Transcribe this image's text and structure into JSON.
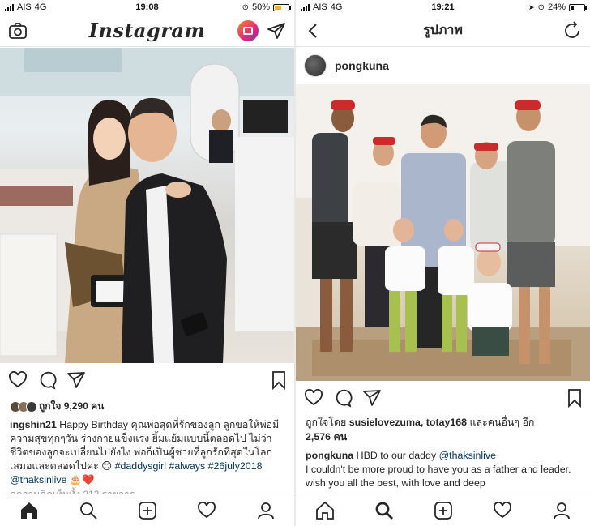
{
  "left": {
    "status": {
      "carrier": "AIS",
      "network": "4G",
      "time": "19:08",
      "battery": "50%"
    },
    "header": {
      "logo": "Instagram"
    },
    "post": {
      "likes_text": "ถูกใจ 9,290 คน",
      "caption_user": "ingshin21",
      "caption_text": " Happy Birthday คุณพ่อสุดที่รักของลูก ลูกขอให้พ่อมีความสุขทุกๆวัน ร่างกายแข็งแรง ยิ้มแย้มแบบนี้ตลอดไป ไม่ว่าชีวิตของลูกจะเปลี่ยนไปยังไง พ่อก็เป็นผู้ชายที่ลูกรักที่สุดในโลกเสมอและตลอดไปค่ะ 😊 ",
      "hashtags": "#daddysgirl #always #26july2018",
      "mention": "@thaksinlive",
      "emoji_tail": " 🎂❤️",
      "comments_link": "ดูความคิดเห็นทั้ง 213 รายการ"
    }
  },
  "right": {
    "status": {
      "carrier": "AIS",
      "network": "4G",
      "time": "19:21",
      "battery": "24%"
    },
    "header": {
      "title": "รูปภาพ"
    },
    "post": {
      "username": "pongkuna",
      "liked_by_prefix": "ถูกใจโดย ",
      "liked_by_users": "susielovezuma, totay168",
      "liked_by_suffix": " และคนอื่นๆ อีก",
      "liked_count": "2,576 คน",
      "caption_user": "pongkuna",
      "caption_text": " HBD to our daddy ",
      "mention": "@thaksinlive",
      "caption_line2": "I couldn't be more proud to have you as a father and leader. wish you all the best, with love and deep"
    }
  },
  "colors": {
    "accent": "#262626",
    "tag": "#003569",
    "heart": "#ed4956"
  }
}
